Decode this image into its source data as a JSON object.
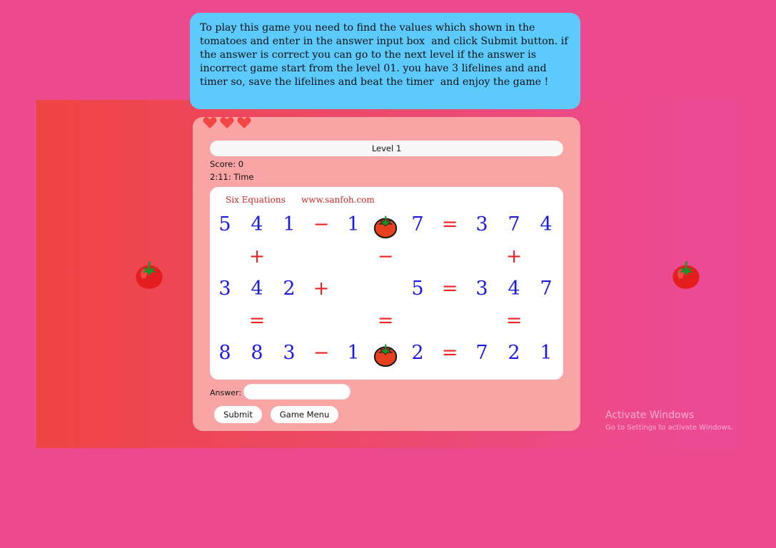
{
  "instructions": "To play this game you need to find the values which shown in the tomatoes and enter in the answer input box  and click Submit button. if the answer is correct you can go to the next level if the answer is incorrect game start from the level 01. you have 3 lifelines and and timer so, save the lifelines and beat the timer  and enjoy the game !",
  "lifelines": 3,
  "level": "Level 1",
  "score": "Score: 0",
  "timer": "2:11: Time",
  "puzzle": {
    "title": "Six Equations",
    "site": "www.sanfoh.com",
    "rows": [
      [
        "5",
        "4",
        "1",
        "−",
        "1",
        "tomato",
        "7",
        "=",
        "3",
        "7",
        "4"
      ],
      [
        "",
        "+",
        "",
        "",
        "",
        "−",
        "",
        "",
        "",
        "+",
        ""
      ],
      [
        "3",
        "4",
        "2",
        "+",
        "",
        "",
        "5",
        "=",
        "3",
        "4",
        "7"
      ],
      [
        "",
        "=",
        "",
        "",
        "",
        "=",
        "",
        "",
        "",
        "=",
        ""
      ],
      [
        "8",
        "8",
        "3",
        "−",
        "1",
        "tomato",
        "2",
        "=",
        "7",
        "2",
        "1"
      ]
    ]
  },
  "answer": {
    "label": "Answer:",
    "value": "",
    "placeholder": ""
  },
  "buttons": {
    "submit": "Submit",
    "menu": "Game Menu"
  },
  "watermark": {
    "title": "Activate Windows",
    "subtitle": "Go to Settings to activate Windows."
  },
  "icons": {
    "side": "tomato-icon",
    "life": "heart-icon"
  },
  "colors": {
    "background": "#ec4a8c",
    "instructions_panel": "#5ccafc",
    "card": "#f9a5a5",
    "digits": "#1a1ae0",
    "operators": "#ee2222",
    "heart": "#f44545"
  }
}
